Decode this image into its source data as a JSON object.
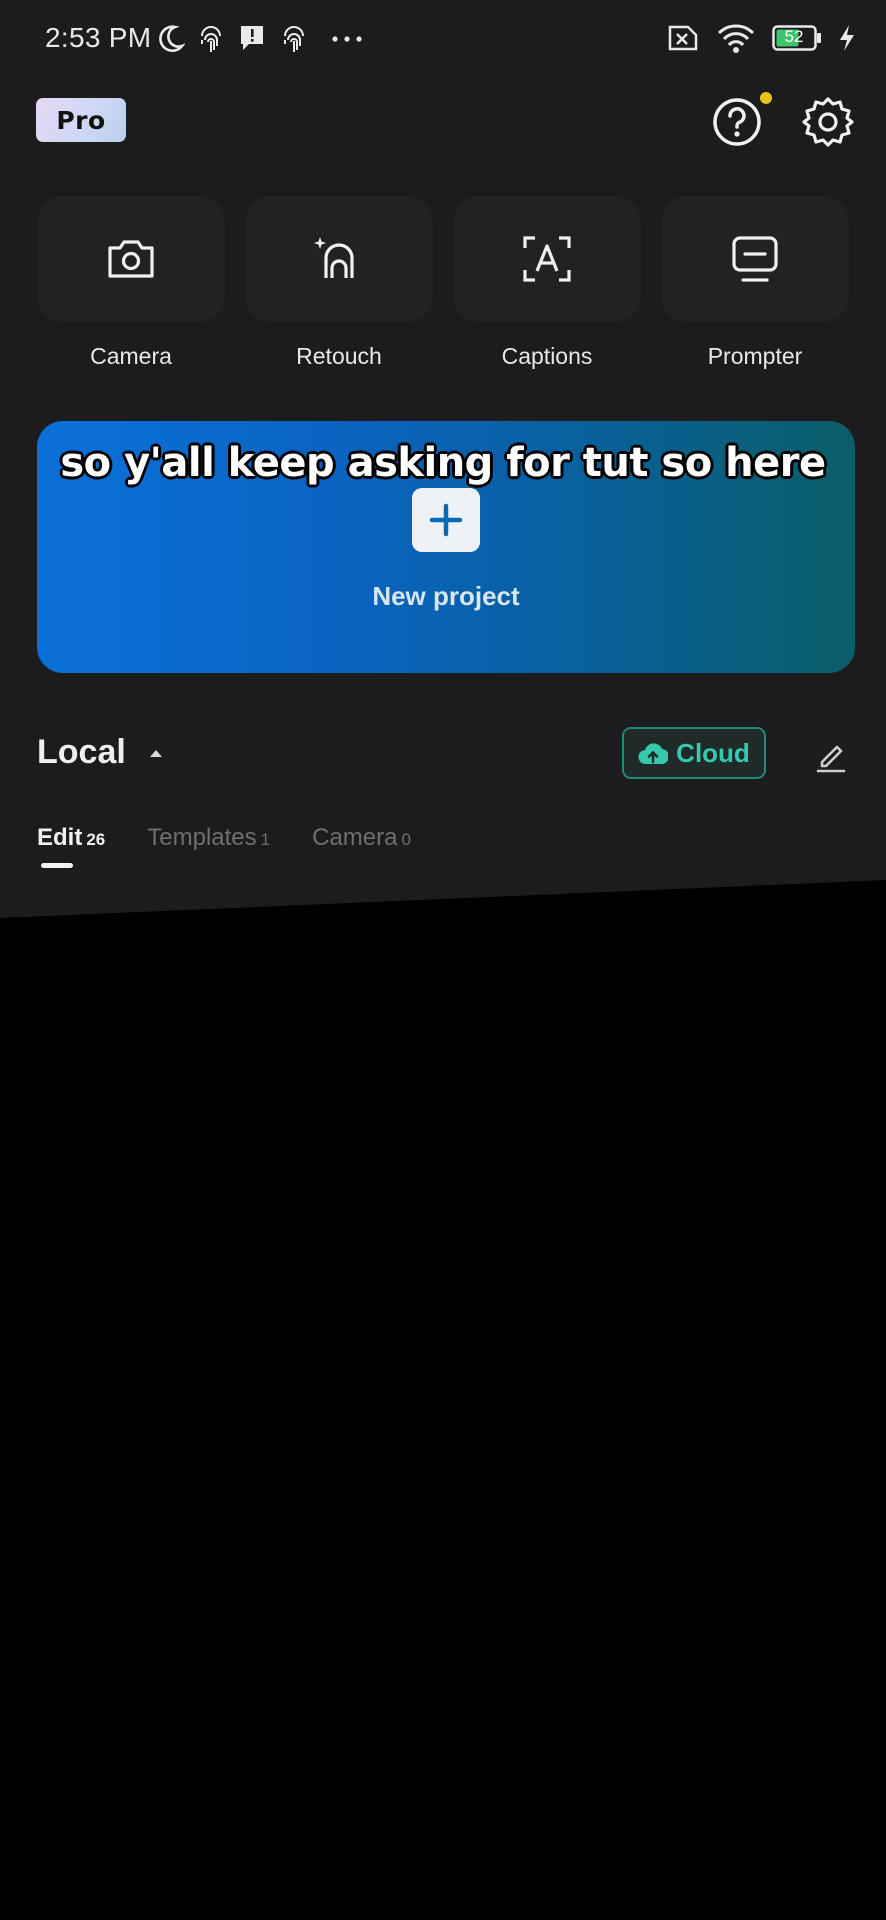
{
  "status_bar": {
    "time": "2:53 PM",
    "battery": "52"
  },
  "header": {
    "pro_label": "Pro"
  },
  "tools": [
    {
      "label": "Camera",
      "icon": "camera-icon"
    },
    {
      "label": "Retouch",
      "icon": "retouch-icon"
    },
    {
      "label": "Captions",
      "icon": "captions-icon"
    },
    {
      "label": "Prompter",
      "icon": "prompter-icon"
    }
  ],
  "new_project": {
    "label": "New project"
  },
  "overlay_caption": "so y'all keep asking for tut so here",
  "local": {
    "title": "Local",
    "cloud_label": "Cloud"
  },
  "tabs": [
    {
      "label": "Edit",
      "count": "26"
    },
    {
      "label": "Templates",
      "count": "1"
    },
    {
      "label": "Camera",
      "count": "0"
    }
  ],
  "colors": {
    "background": "#1c1c1e",
    "accent_teal": "#35c9b0",
    "help_dot": "#e8c21a"
  }
}
